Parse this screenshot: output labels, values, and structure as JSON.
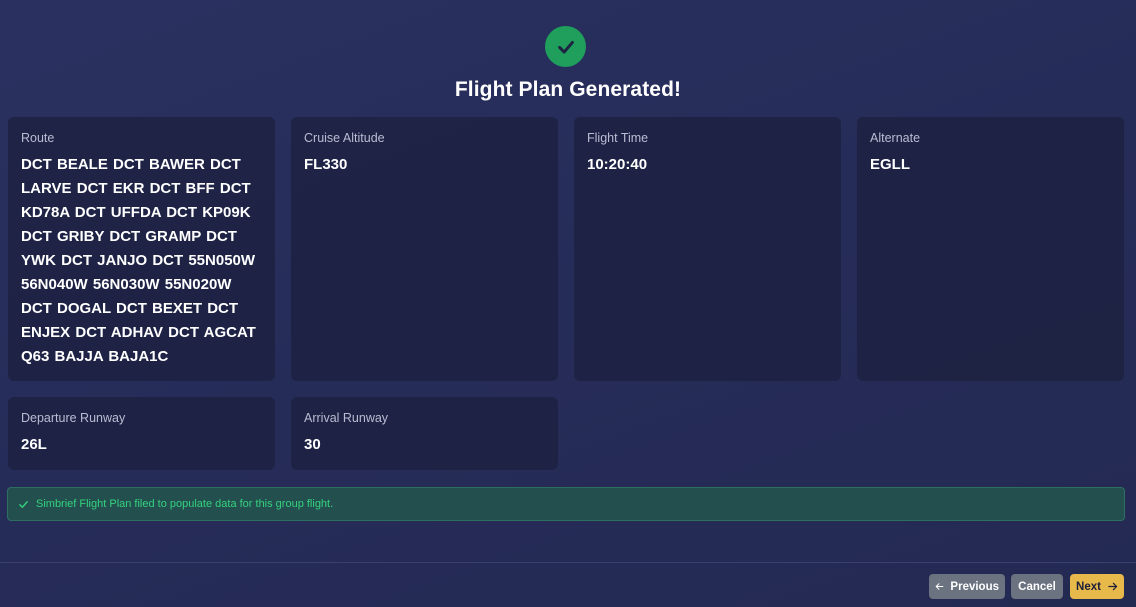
{
  "header": {
    "title": "Flight Plan Generated!",
    "icon": "check-icon",
    "icon_color": "#1f9e5c"
  },
  "cards": {
    "route": {
      "label": "Route",
      "value": "DCT BEALE DCT BAWER DCT LARVE DCT EKR DCT BFF DCT KD78A DCT UFFDA DCT KP09K DCT GRIBY DCT GRAMP DCT YWK DCT JANJO DCT 55N050W 56N040W 56N030W 55N020W DCT DOGAL DCT BEXET DCT ENJEX DCT ADHAV DCT AGCAT Q63 BAJJA BAJA1C"
    },
    "cruise_altitude": {
      "label": "Cruise Altitude",
      "value": "FL330"
    },
    "flight_time": {
      "label": "Flight Time",
      "value": "10:20:40"
    },
    "alternate": {
      "label": "Alternate",
      "value": "EGLL"
    },
    "departure_runway": {
      "label": "Departure Runway",
      "value": "26L"
    },
    "arrival_runway": {
      "label": "Arrival Runway",
      "value": "30"
    }
  },
  "notice": {
    "text": "Simbrief Flight Plan filed to populate data for this group flight.",
    "icon": "check-icon",
    "color": "#34d17e"
  },
  "footer": {
    "previous_label": "Previous",
    "cancel_label": "Cancel",
    "next_label": "Next",
    "next_color": "#e7b84a"
  }
}
